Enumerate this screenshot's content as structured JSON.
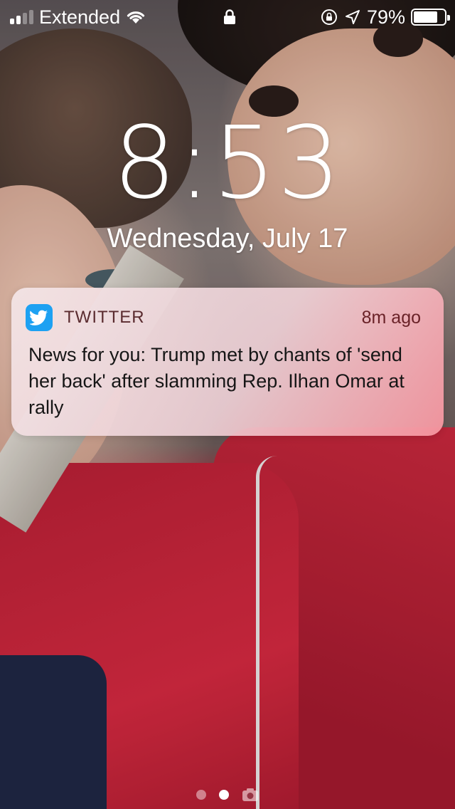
{
  "status_bar": {
    "carrier": "Extended",
    "battery_percent": "79%",
    "battery_level": 0.79
  },
  "lock_screen": {
    "time": "8:53",
    "date": "Wednesday, July 17"
  },
  "notification": {
    "app_name": "TWITTER",
    "time_ago": "8m ago",
    "message": "News for you: Trump met by chants of 'send her back' after slamming Rep. Ilhan Omar at rally",
    "app_icon": "twitter-bird-icon",
    "app_icon_color": "#1da1f2"
  },
  "page_indicator": {
    "pages": 2,
    "active_page": 2,
    "trailing_icon": "camera-icon"
  }
}
